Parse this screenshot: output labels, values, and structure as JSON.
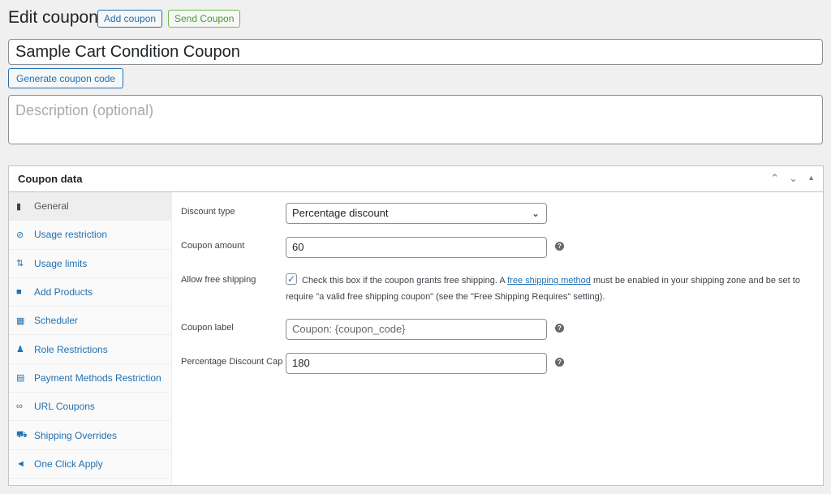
{
  "header": {
    "title": "Edit coupon",
    "add_label": "Add coupon",
    "send_label": "Send Coupon"
  },
  "coupon": {
    "title": "Sample Cart Condition Coupon",
    "generate_label": "Generate coupon code",
    "description_placeholder": "Description (optional)"
  },
  "panel": {
    "title": "Coupon data",
    "tabs": [
      {
        "label": "General",
        "icon": "ticket-icon"
      },
      {
        "label": "Usage restriction",
        "icon": "block-icon"
      },
      {
        "label": "Usage limits",
        "icon": "limits-icon"
      },
      {
        "label": "Add Products",
        "icon": "bag-icon"
      },
      {
        "label": "Scheduler",
        "icon": "calendar-icon"
      },
      {
        "label": "Role Restrictions",
        "icon": "user-icon"
      },
      {
        "label": "Payment Methods Restriction",
        "icon": "card-icon"
      },
      {
        "label": "URL Coupons",
        "icon": "link-icon"
      },
      {
        "label": "Shipping Overrides",
        "icon": "truck-icon"
      },
      {
        "label": "One Click Apply",
        "icon": "megaphone-icon"
      }
    ],
    "active_tab": "General",
    "fields": {
      "discount_type": {
        "label": "Discount type",
        "value": "Percentage discount"
      },
      "amount": {
        "label": "Coupon amount",
        "value": "60"
      },
      "free_shipping": {
        "label": "Allow free shipping",
        "checked": true,
        "text_before": "Check this box if the coupon grants free shipping. A ",
        "link": "free shipping method",
        "text_after": " must be enabled in your shipping zone and be set to require \"a valid free shipping coupon\" (see the \"Free Shipping Requires\" setting)."
      },
      "coupon_label": {
        "label": "Coupon label",
        "placeholder": "Coupon: {coupon_code}"
      },
      "discount_cap": {
        "label": "Percentage Discount Cap",
        "value": "180"
      }
    }
  }
}
